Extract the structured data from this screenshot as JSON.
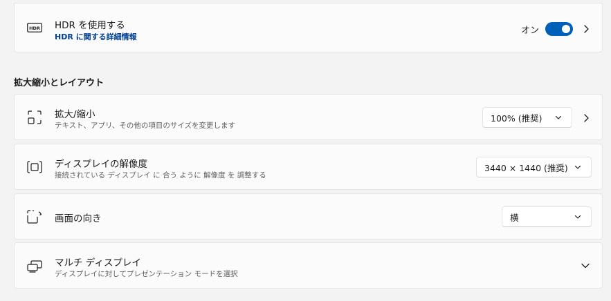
{
  "hdr": {
    "title": "HDR を使用する",
    "link": "HDR に関する詳細情報",
    "toggle_label": "オン",
    "toggle_on": true,
    "icon": "hdr-icon"
  },
  "section": {
    "heading": "拡大縮小とレイアウト"
  },
  "scale": {
    "title": "拡大/縮小",
    "subtitle": "テキスト、アプリ、その他の項目のサイズを変更します",
    "value": "100% (推奨)",
    "icon": "scale-icon"
  },
  "resolution": {
    "title": "ディスプレイの解像度",
    "subtitle": "接続されている ディスプレイ に 合う ように 解像度 を 調整する",
    "value": "3440 × 1440 (推奨)",
    "icon": "resolution-icon"
  },
  "orientation": {
    "title": "画面の向き",
    "value": "横",
    "icon": "orientation-icon"
  },
  "multi": {
    "title": "マルチ ディスプレイ",
    "subtitle": "ディスプレイに対してプレゼンテーション モードを選択",
    "icon": "multi-display-icon"
  },
  "colors": {
    "accent": "#005fb8",
    "link": "#003e92",
    "card": "#fbfbfb",
    "background": "#f3f3f3"
  }
}
